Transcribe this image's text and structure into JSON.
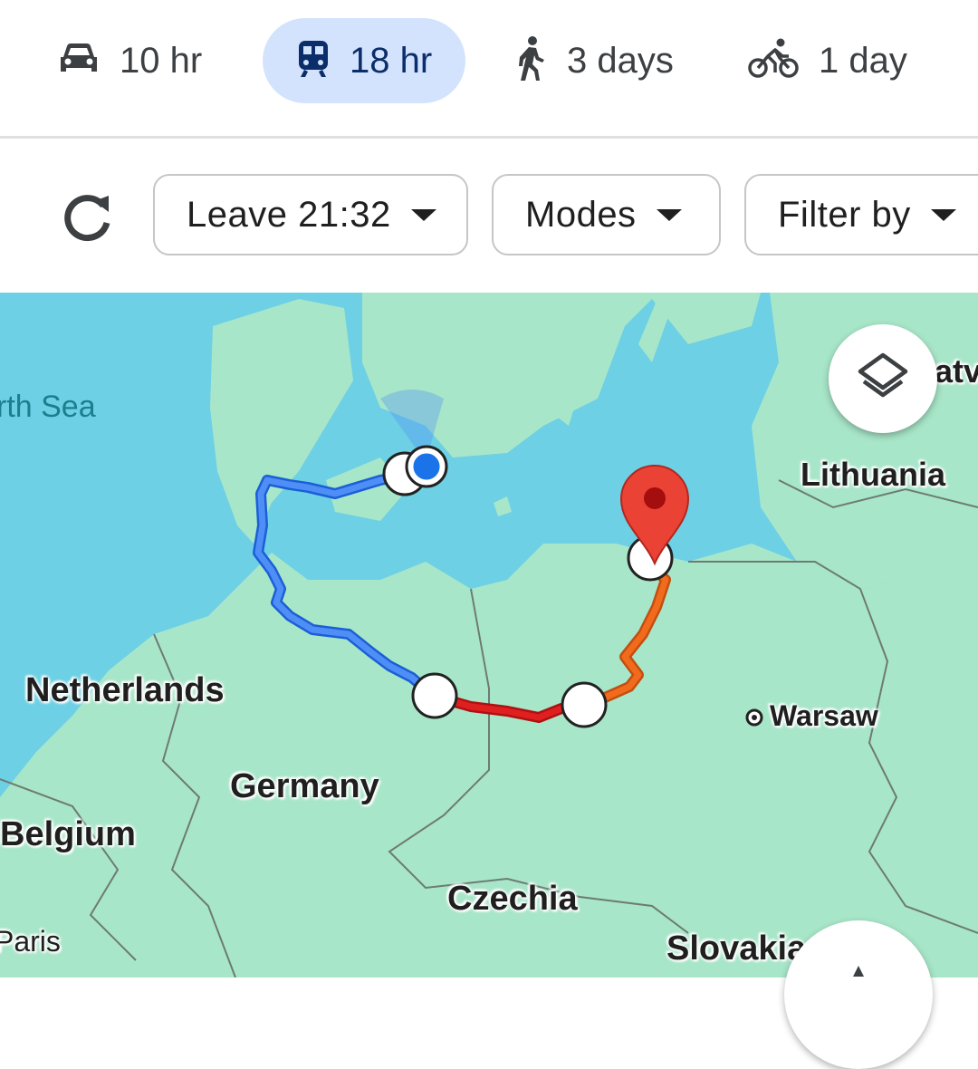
{
  "travel_modes": [
    {
      "mode": "driving",
      "icon": "car-icon",
      "label": "10 hr",
      "selected": false
    },
    {
      "mode": "transit",
      "icon": "train-icon",
      "label": "18 hr",
      "selected": true
    },
    {
      "mode": "walking",
      "icon": "walking-person-icon",
      "label": "3 days",
      "selected": false
    },
    {
      "mode": "cycling",
      "icon": "bicycle-icon",
      "label": "1 day",
      "selected": false
    }
  ],
  "options": {
    "refresh_icon": "refresh-icon",
    "leave_label": "Leave 21:32",
    "modes_label": "Modes",
    "filter_label": "Filter by"
  },
  "map": {
    "labels": {
      "sea": "rth Sea",
      "latvia": "atv",
      "lithuania": "Lithuania",
      "netherlands": "Netherlands",
      "warsaw": "Warsaw",
      "germany": "Germany",
      "belgium": "Belgium",
      "czechia": "Czechia",
      "paris": "Paris",
      "slovakia": "Slovakia"
    },
    "route_colors": {
      "segment1": "#4285f4",
      "segment2": "#d81b1b",
      "segment3": "#f26b1d"
    },
    "colors": {
      "water": "#6dd0e4",
      "land": "#a8e6c9",
      "accent": "#d3e3fd",
      "destination_pin": "#ea4335",
      "origin_dot": "#1a73e8"
    },
    "controls": {
      "layers_icon": "layers-icon",
      "compass_icon": "compass-icon"
    }
  }
}
